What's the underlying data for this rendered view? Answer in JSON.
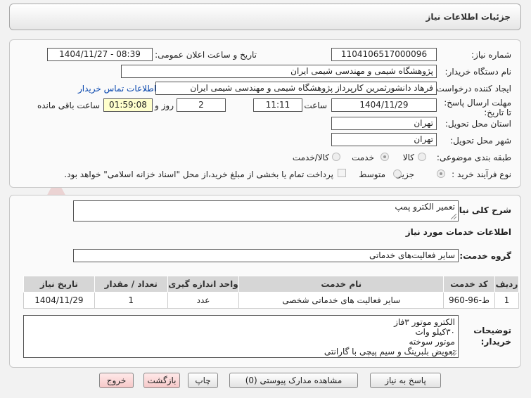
{
  "page": {
    "title": "جزئیات اطلاعات نیاز"
  },
  "labels": {
    "need_number": "شماره نیاز:",
    "announce_datetime": "تاریخ و ساعت اعلان عمومی:",
    "buyer_org": "نام دستگاه خریدار:",
    "requester": "ایجاد کننده درخواست:",
    "deadline": "مهلت ارسال پاسخ: تا تاریخ:",
    "time": "ساعت",
    "days_and": "روز و",
    "remaining": "ساعت باقی مانده",
    "province": "استان محل تحویل:",
    "city": "شهر محل تحویل:",
    "category": "طبقه بندی موضوعی:",
    "process_type": "نوع فرآیند خرید :",
    "description": "شرح کلی نیاز:",
    "services_info": "اطلاعات خدمات مورد نیاز",
    "service_group": "گروه خدمت:",
    "buyer_notes": "توضیحات خریدار:"
  },
  "values": {
    "need_number": "1104106517000096",
    "announce_datetime": "1404/11/27 - 08:39",
    "buyer_org": "پژوهشگاه شیمی و مهندسی شیمی ایران",
    "requester": "فرهاد دانشورثمرین کارپرداز پژوهشگاه شیمی و مهندسی شیمی ایران",
    "contact_link": "اطلاعات تماس خریدار",
    "deadline_date": "1404/11/29",
    "deadline_time": "11:11",
    "days": "2",
    "remaining_time": "01:59:08",
    "province": "تهران",
    "city": "تهران",
    "description": "تعمیر الکترو پمپ",
    "service_group": "سایر فعالیت‌های خدماتی"
  },
  "category_options": [
    "کالا",
    "خدمت",
    "کالا/خدمت"
  ],
  "category_selected": "خدمت",
  "process_options": [
    "جزیی",
    "متوسط"
  ],
  "process_selected": "جزیی",
  "payment_note": "پرداخت تمام یا بخشی از مبلغ خرید،از محل \"اسناد خزانه اسلامی\" خواهد بود.",
  "table": {
    "headers": [
      "ردیف",
      "کد خدمت",
      "نام خدمت",
      "واحد اندازه گیری",
      "تعداد / مقدار",
      "تاریخ نیاز"
    ],
    "rows": [
      [
        "1",
        "ط-96-960",
        "سایر فعالیت های خدماتی شخصی",
        "عدد",
        "1",
        "1404/11/29"
      ]
    ]
  },
  "buyer_notes_lines": [
    "الکترو موتور ۳فاز",
    "۳۰کیلو وات",
    "موتور سوخته",
    "تعویض بلبرینگ و سیم پیچی با گارانتی"
  ],
  "buttons": {
    "reply": "پاسخ به نیاز",
    "attachments": "مشاهده مدارک پیوستی (0)",
    "print": "چاپ",
    "back": "بازگشت",
    "exit": "خروج"
  },
  "watermark": "AriaTender.net"
}
